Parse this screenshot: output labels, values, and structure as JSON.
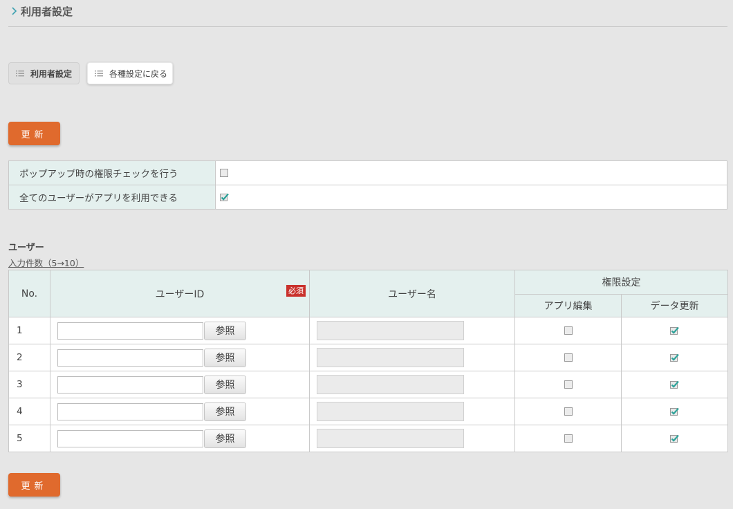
{
  "page": {
    "title": "利用者設定"
  },
  "tabs": {
    "current": "利用者設定",
    "back": "各種設定に戻る"
  },
  "buttons": {
    "update": "更新"
  },
  "settings": [
    {
      "label": "ポップアップ時の権限チェックを行う",
      "checked": false
    },
    {
      "label": "全てのユーザーがアプリを利用できる",
      "checked": true
    }
  ],
  "users": {
    "heading": "ユーザー",
    "count_link": "入力件数（5→10）",
    "columns": {
      "no": "No.",
      "user_id": "ユーザーID",
      "required": "必須",
      "user_name": "ユーザー名",
      "permission": "権限設定",
      "app_edit": "アプリ編集",
      "data_update": "データ更新"
    },
    "reference_button": "参照",
    "rows": [
      {
        "no": "1",
        "user_id": "",
        "user_name": "",
        "app_edit": false,
        "data_update": true
      },
      {
        "no": "2",
        "user_id": "",
        "user_name": "",
        "app_edit": false,
        "data_update": true
      },
      {
        "no": "3",
        "user_id": "",
        "user_name": "",
        "app_edit": false,
        "data_update": true
      },
      {
        "no": "4",
        "user_id": "",
        "user_name": "",
        "app_edit": false,
        "data_update": true
      },
      {
        "no": "5",
        "user_id": "",
        "user_name": "",
        "app_edit": false,
        "data_update": true
      }
    ]
  },
  "icons": {
    "title": "chevron-right-icon",
    "tab": "list-icon",
    "check": "check-icon"
  },
  "colors": {
    "accent": "#e06a2d",
    "header_bg": "#e4f0ee",
    "required": "#c9312c",
    "check": "#2aa198"
  }
}
